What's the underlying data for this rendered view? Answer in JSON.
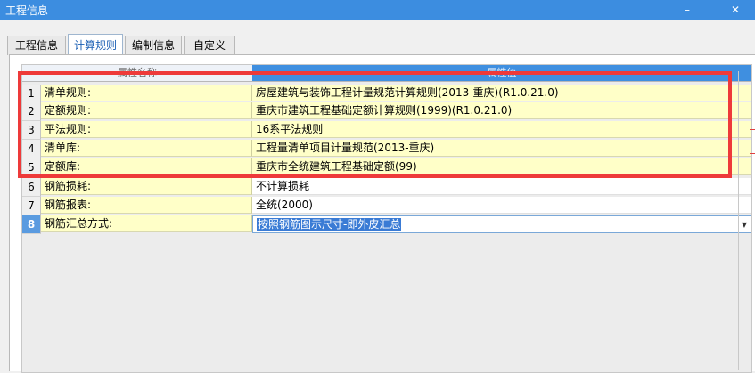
{
  "window": {
    "title": "工程信息",
    "minimize": "–",
    "close": "✕"
  },
  "tabs": [
    {
      "label": "工程信息"
    },
    {
      "label": "计算规则"
    },
    {
      "label": "编制信息"
    },
    {
      "label": "自定义"
    }
  ],
  "grid": {
    "headers": {
      "name": "属性名称",
      "value": "属性值"
    },
    "rows": [
      {
        "num": "1",
        "name": "清单规则:",
        "value": "房屋建筑与装饰工程计量规范计算规则(2013-重庆)(R1.0.21.0)"
      },
      {
        "num": "2",
        "name": "定额规则:",
        "value": "重庆市建筑工程基础定额计算规则(1999)(R1.0.21.0)"
      },
      {
        "num": "3",
        "name": "平法规则:",
        "value": "16系平法规则"
      },
      {
        "num": "4",
        "name": "清单库:",
        "value": "工程量清单项目计量规范(2013-重庆)"
      },
      {
        "num": "5",
        "name": "定额库:",
        "value": "重庆市全统建筑工程基础定额(99)"
      },
      {
        "num": "6",
        "name": "钢筋损耗:",
        "value": "不计算损耗"
      },
      {
        "num": "7",
        "name": "钢筋报表:",
        "value": "全统(2000)"
      },
      {
        "num": "8",
        "name": "钢筋汇总方式:",
        "value": "按照钢筋图示尺寸-即外皮汇总"
      }
    ]
  },
  "colors": {
    "annotation": "#ee3a3a",
    "titlebar": "#3c8de0",
    "row_highlight": "#ffffc8"
  }
}
